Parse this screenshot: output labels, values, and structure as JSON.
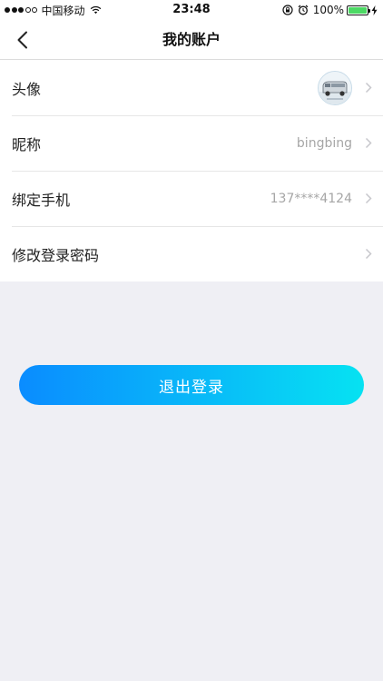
{
  "status_bar": {
    "carrier": "中国移动",
    "time": "23:48",
    "battery_percent": "100%",
    "battery_level": 1.0,
    "signal_bars_filled": 3,
    "signal_bars_total": 5,
    "icons": [
      "wifi-icon",
      "orientation-lock-icon",
      "alarm-icon",
      "battery-icon",
      "charging-icon"
    ]
  },
  "nav": {
    "title": "我的账户",
    "back_icon": "chevron-left-icon"
  },
  "account_rows": [
    {
      "label": "头像",
      "value": "",
      "has_avatar": true
    },
    {
      "label": "昵称",
      "value": "bingbing"
    },
    {
      "label": "绑定手机",
      "value": "137****4124"
    },
    {
      "label": "修改登录密码",
      "value": ""
    }
  ],
  "logout": {
    "label": "退出登录"
  },
  "colors": {
    "accent_start": "#0a8cff",
    "accent_end": "#06e2f2",
    "background": "#efeff4",
    "battery": "#4cd964"
  }
}
